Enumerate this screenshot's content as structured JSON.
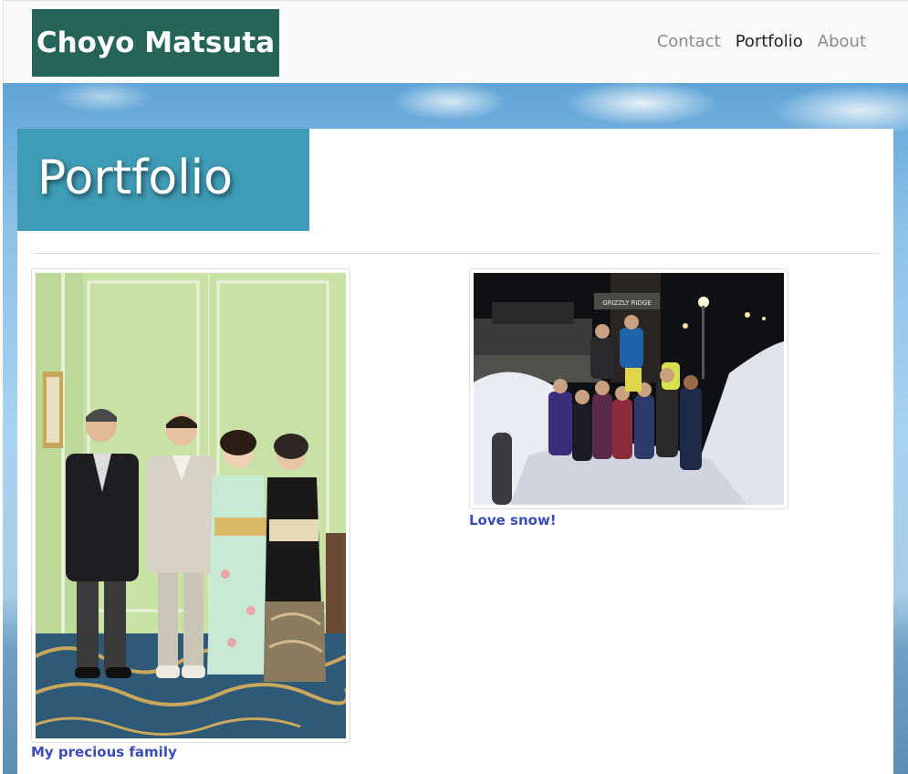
{
  "navbar": {
    "brand": "Choyo Matsuta",
    "links": [
      "Contact",
      "Portfolio",
      "About"
    ],
    "active": "Portfolio"
  },
  "page": {
    "title": "Portfolio"
  },
  "portfolio": {
    "items": [
      {
        "caption": "My precious family",
        "image_content": "family-formal-portrait"
      },
      {
        "caption": "Love snow!",
        "image_content": "group-snow-night-photo",
        "sign_text": "GRIZZLY RIDGE"
      }
    ]
  },
  "colors": {
    "brand_bg": "#26645a",
    "title_bg": "#3f9cb6",
    "caption_link": "#3b4bb8",
    "nav_active": "#212121",
    "nav_inactive": "#8a8a8a"
  }
}
